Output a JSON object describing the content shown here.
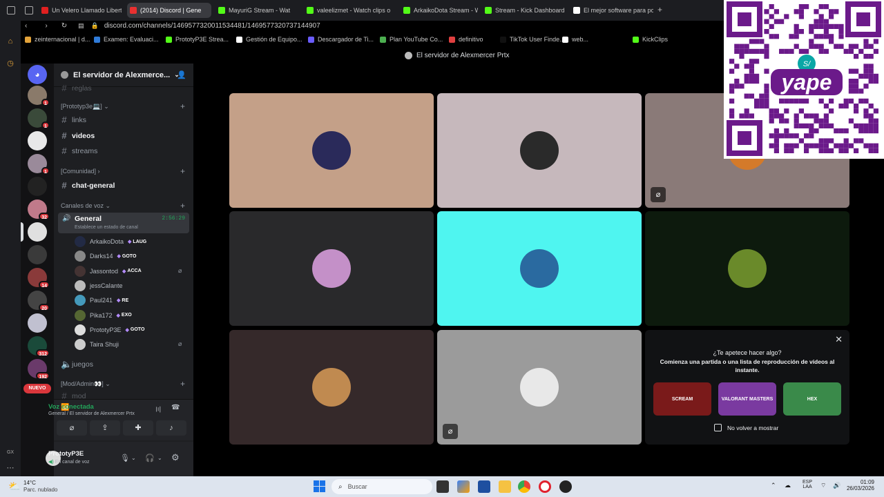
{
  "browser": {
    "tabs": [
      {
        "label": "Un Velero Llamado Liberta",
        "color": "#e02020",
        "active": false
      },
      {
        "label": "(2014) Discord | Gene",
        "color": "#e83030",
        "active": true
      },
      {
        "label": "MayuriG Stream - Wat",
        "color": "#53fc18",
        "active": false
      },
      {
        "label": "valeelizmet - Watch clips o",
        "color": "#53fc18",
        "active": false
      },
      {
        "label": "ArkaikoDota Stream - Wat",
        "color": "#53fc18",
        "active": false
      },
      {
        "label": "Stream - Kick Dashboard",
        "color": "#53fc18",
        "active": false
      },
      {
        "label": "El mejor software para pol",
        "color": "#ffffff",
        "active": false
      }
    ],
    "url": "discord.com/channels/1469577320011534481/1469577320737144907",
    "bookmarks": [
      {
        "label": "zeinternacional | d...",
        "color": "#e3a33a"
      },
      {
        "label": "Examen: Evaluaci...",
        "color": "#2f7bd9"
      },
      {
        "label": "PrototyP3E Strea...",
        "color": "#53fc18"
      },
      {
        "label": "Gestión de Equipo...",
        "color": "#ffffff"
      },
      {
        "label": "Descargador de Ti...",
        "color": "#6a5cff"
      },
      {
        "label": "Plan YouTube Co...",
        "color": "#4caf50"
      },
      {
        "label": "definitivo",
        "color": "#e04040"
      },
      {
        "label": "TikTok User Finde...",
        "color": "#111111"
      },
      {
        "label": "web...",
        "color": "#ffffff"
      },
      {
        "label": "KickClips",
        "color": "#53fc18"
      }
    ]
  },
  "discord": {
    "topbar_title": "El servidor de Alexmercer Prtx",
    "server_name": "El servidor de Alexmerce...",
    "servers": [
      {
        "badge": "1",
        "color": "#8a7a6a"
      },
      {
        "badge": "1",
        "color": "#3a4a3a"
      },
      {
        "badge": "",
        "color": "#e8e8e8"
      },
      {
        "badge": "1",
        "color": "#9a8a9a"
      },
      {
        "badge": "",
        "color": "#222222"
      },
      {
        "badge": "32",
        "color": "#c07a8a"
      },
      {
        "badge": "",
        "color": "#e0e0e0"
      },
      {
        "badge": "",
        "color": "#3a3a3a"
      },
      {
        "badge": "14",
        "color": "#8a3a3a"
      },
      {
        "badge": "20",
        "color": "#444444"
      },
      {
        "badge": "",
        "color": "#c0c0d0"
      },
      {
        "badge": "312",
        "color": "#1a4a3a"
      },
      {
        "badge": "192",
        "color": "#6a3a6a"
      }
    ],
    "nuevo_label": "NUEVO",
    "channels": {
      "top_partial": "reglas",
      "cat_prototyp3e": "[Prototyp3e💻]",
      "links": "links",
      "videos": "videos",
      "streams": "streams",
      "cat_comunidad": "[Comunidad]",
      "chat_general": "chat-general",
      "cat_voz": "Canales de voz",
      "general": "General",
      "general_time": "2:56:29",
      "general_status": "Establece un estado de canal",
      "juegos": "juegos",
      "cat_mod": "[Mod/Admin👀]",
      "mod_partial": "mod"
    },
    "members": [
      {
        "name": "ArkaikoDota",
        "tag": "LAUG",
        "color": "#222a44",
        "muted": false
      },
      {
        "name": "Darks14",
        "tag": "GOTO",
        "color": "#888888",
        "muted": false
      },
      {
        "name": "Jassontod",
        "tag": "ACCA",
        "color": "#443333",
        "muted": true
      },
      {
        "name": "jessCaIante",
        "tag": "",
        "color": "#bbbbbb",
        "muted": false
      },
      {
        "name": "Paul241",
        "tag": "RE",
        "color": "#4499bb",
        "muted": false
      },
      {
        "name": "Pika172",
        "tag": "EXO",
        "color": "#556633",
        "muted": false
      },
      {
        "name": "PrototyP3E",
        "tag": "GOTO",
        "color": "#dddddd",
        "muted": false
      },
      {
        "name": "Taira Shuji",
        "tag": "",
        "color": "#cccccc",
        "muted": true
      }
    ],
    "voice": {
      "status": "Voz conectada",
      "location": "General / El servidor de Alexmercer Prtx"
    },
    "user": {
      "name": "PrototyP3E",
      "status": "En canal de voz"
    },
    "tiles": [
      {
        "bg": "#c4a088",
        "avatar": "#2a2a5a",
        "muted": false
      },
      {
        "bg": "#c6b8bc",
        "avatar": "#2a2a2a",
        "muted": false
      },
      {
        "bg": "#8a7a78",
        "avatar": "#d47a2a",
        "muted": true
      },
      {
        "bg": "#29292b",
        "avatar": "#c490c8",
        "muted": false
      },
      {
        "bg": "#4ff5f0",
        "avatar": "#2a6aa0",
        "muted": false
      },
      {
        "bg": "#0d1a0d",
        "avatar": "#6a8a2a",
        "muted": false
      },
      {
        "bg": "#35292a",
        "avatar": "#c08a50",
        "muted": false
      },
      {
        "bg": "#9b9b9b",
        "avatar": "#e8e8e8",
        "muted": true
      }
    ],
    "activity": {
      "title": "¿Te apetece hacer algo?",
      "subtitle": "Comienza una partida o una lista de reproducción de vídeos al instante.",
      "checkbox_label": "No volver a mostrar",
      "games": [
        {
          "label": "SCREAM",
          "color": "#7a1a1a"
        },
        {
          "label": "VALORANT MASTERS",
          "color": "#7a3aa0"
        },
        {
          "label": "HEX",
          "color": "#3a8a4a"
        }
      ]
    }
  },
  "qr": {
    "brand": "yape",
    "symbol": "S/"
  },
  "taskbar": {
    "weather_temp": "14°C",
    "weather_desc": "Parc. nublado",
    "search_placeholder": "Buscar",
    "lang": "ESP",
    "lang_sub": "LAA",
    "time": "01:09",
    "date": "26/03/2026"
  }
}
